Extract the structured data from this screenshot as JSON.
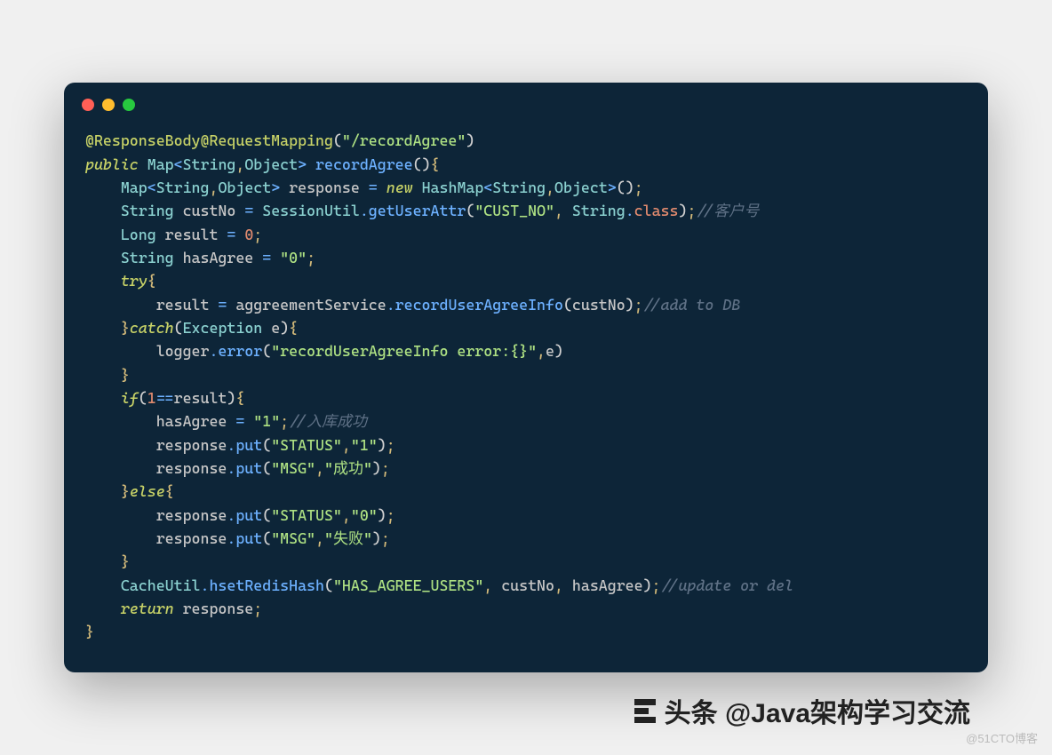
{
  "window": {
    "dots": [
      "red",
      "yellow",
      "green"
    ]
  },
  "code": {
    "lines": [
      [
        {
          "cls": "annotation",
          "t": "@ResponseBody@RequestMapping"
        },
        {
          "cls": "paren",
          "t": "("
        },
        {
          "cls": "string",
          "t": "\"/recordAgree\""
        },
        {
          "cls": "paren",
          "t": ")"
        }
      ],
      [
        {
          "cls": "keyword",
          "t": "public"
        },
        {
          "cls": "white",
          "t": " "
        },
        {
          "cls": "type",
          "t": "Map"
        },
        {
          "cls": "angle",
          "t": "<"
        },
        {
          "cls": "type",
          "t": "String"
        },
        {
          "cls": "punc",
          "t": ","
        },
        {
          "cls": "type",
          "t": "Object"
        },
        {
          "cls": "angle",
          "t": ">"
        },
        {
          "cls": "white",
          "t": " "
        },
        {
          "cls": "method",
          "t": "recordAgree"
        },
        {
          "cls": "paren",
          "t": "()"
        },
        {
          "cls": "punc",
          "t": "{"
        }
      ],
      [
        {
          "cls": "white",
          "t": "    "
        },
        {
          "cls": "type",
          "t": "Map"
        },
        {
          "cls": "angle",
          "t": "<"
        },
        {
          "cls": "type",
          "t": "String"
        },
        {
          "cls": "punc",
          "t": ","
        },
        {
          "cls": "type",
          "t": "Object"
        },
        {
          "cls": "angle",
          "t": ">"
        },
        {
          "cls": "white",
          "t": " "
        },
        {
          "cls": "identifier",
          "t": "response "
        },
        {
          "cls": "operator",
          "t": "="
        },
        {
          "cls": "white",
          "t": " "
        },
        {
          "cls": "keyword",
          "t": "new"
        },
        {
          "cls": "white",
          "t": " "
        },
        {
          "cls": "type",
          "t": "HashMap"
        },
        {
          "cls": "angle",
          "t": "<"
        },
        {
          "cls": "type",
          "t": "String"
        },
        {
          "cls": "punc",
          "t": ","
        },
        {
          "cls": "type",
          "t": "Object"
        },
        {
          "cls": "angle",
          "t": ">"
        },
        {
          "cls": "paren",
          "t": "()"
        },
        {
          "cls": "punc",
          "t": ";"
        }
      ],
      [
        {
          "cls": "white",
          "t": "    "
        },
        {
          "cls": "type",
          "t": "String"
        },
        {
          "cls": "white",
          "t": " "
        },
        {
          "cls": "identifier",
          "t": "custNo "
        },
        {
          "cls": "operator",
          "t": "="
        },
        {
          "cls": "white",
          "t": " "
        },
        {
          "cls": "type",
          "t": "SessionUtil"
        },
        {
          "cls": "dot-op",
          "t": "."
        },
        {
          "cls": "method",
          "t": "getUserAttr"
        },
        {
          "cls": "paren",
          "t": "("
        },
        {
          "cls": "string",
          "t": "\"CUST_NO\""
        },
        {
          "cls": "punc",
          "t": ", "
        },
        {
          "cls": "type",
          "t": "String"
        },
        {
          "cls": "dot-op",
          "t": "."
        },
        {
          "cls": "classlit",
          "t": "class"
        },
        {
          "cls": "paren",
          "t": ")"
        },
        {
          "cls": "punc",
          "t": ";"
        },
        {
          "cls": "comment",
          "t": "//客户号"
        }
      ],
      [
        {
          "cls": "white",
          "t": "    "
        },
        {
          "cls": "type",
          "t": "Long"
        },
        {
          "cls": "white",
          "t": " "
        },
        {
          "cls": "identifier",
          "t": "result "
        },
        {
          "cls": "operator",
          "t": "="
        },
        {
          "cls": "white",
          "t": " "
        },
        {
          "cls": "number",
          "t": "0"
        },
        {
          "cls": "punc",
          "t": ";"
        }
      ],
      [
        {
          "cls": "white",
          "t": "    "
        },
        {
          "cls": "type",
          "t": "String"
        },
        {
          "cls": "white",
          "t": " "
        },
        {
          "cls": "identifier",
          "t": "hasAgree "
        },
        {
          "cls": "operator",
          "t": "="
        },
        {
          "cls": "white",
          "t": " "
        },
        {
          "cls": "string",
          "t": "\"0\""
        },
        {
          "cls": "punc",
          "t": ";"
        }
      ],
      [
        {
          "cls": "white",
          "t": "    "
        },
        {
          "cls": "keyword",
          "t": "try"
        },
        {
          "cls": "punc",
          "t": "{"
        }
      ],
      [
        {
          "cls": "white",
          "t": "        "
        },
        {
          "cls": "identifier",
          "t": "result "
        },
        {
          "cls": "operator",
          "t": "="
        },
        {
          "cls": "white",
          "t": " "
        },
        {
          "cls": "identifier",
          "t": "aggreementService"
        },
        {
          "cls": "dot-op",
          "t": "."
        },
        {
          "cls": "method",
          "t": "recordUserAgreeInfo"
        },
        {
          "cls": "paren",
          "t": "("
        },
        {
          "cls": "identifier",
          "t": "custNo"
        },
        {
          "cls": "paren",
          "t": ")"
        },
        {
          "cls": "punc",
          "t": ";"
        },
        {
          "cls": "comment",
          "t": "//add to DB"
        }
      ],
      [
        {
          "cls": "white",
          "t": "    "
        },
        {
          "cls": "punc",
          "t": "}"
        },
        {
          "cls": "keyword",
          "t": "catch"
        },
        {
          "cls": "paren",
          "t": "("
        },
        {
          "cls": "type",
          "t": "Exception"
        },
        {
          "cls": "white",
          "t": " "
        },
        {
          "cls": "identifier",
          "t": "e"
        },
        {
          "cls": "paren",
          "t": ")"
        },
        {
          "cls": "punc",
          "t": "{"
        }
      ],
      [
        {
          "cls": "white",
          "t": "        "
        },
        {
          "cls": "identifier",
          "t": "logger"
        },
        {
          "cls": "dot-op",
          "t": "."
        },
        {
          "cls": "method",
          "t": "error"
        },
        {
          "cls": "paren",
          "t": "("
        },
        {
          "cls": "string",
          "t": "\"recordUserAgreeInfo error:{}\""
        },
        {
          "cls": "punc",
          "t": ","
        },
        {
          "cls": "identifier",
          "t": "e"
        },
        {
          "cls": "paren",
          "t": ")"
        }
      ],
      [
        {
          "cls": "white",
          "t": "    "
        },
        {
          "cls": "punc",
          "t": "}"
        }
      ],
      [
        {
          "cls": "white",
          "t": "    "
        },
        {
          "cls": "keyword",
          "t": "if"
        },
        {
          "cls": "paren",
          "t": "("
        },
        {
          "cls": "number",
          "t": "1"
        },
        {
          "cls": "operator",
          "t": "=="
        },
        {
          "cls": "identifier",
          "t": "result"
        },
        {
          "cls": "paren",
          "t": ")"
        },
        {
          "cls": "punc",
          "t": "{"
        }
      ],
      [
        {
          "cls": "white",
          "t": "        "
        },
        {
          "cls": "identifier",
          "t": "hasAgree "
        },
        {
          "cls": "operator",
          "t": "="
        },
        {
          "cls": "white",
          "t": " "
        },
        {
          "cls": "string",
          "t": "\"1\""
        },
        {
          "cls": "punc",
          "t": ";"
        },
        {
          "cls": "comment",
          "t": "//入库成功"
        }
      ],
      [
        {
          "cls": "white",
          "t": "        "
        },
        {
          "cls": "identifier",
          "t": "response"
        },
        {
          "cls": "dot-op",
          "t": "."
        },
        {
          "cls": "method",
          "t": "put"
        },
        {
          "cls": "paren",
          "t": "("
        },
        {
          "cls": "string",
          "t": "\"STATUS\""
        },
        {
          "cls": "punc",
          "t": ","
        },
        {
          "cls": "string",
          "t": "\"1\""
        },
        {
          "cls": "paren",
          "t": ")"
        },
        {
          "cls": "punc",
          "t": ";"
        }
      ],
      [
        {
          "cls": "white",
          "t": "        "
        },
        {
          "cls": "identifier",
          "t": "response"
        },
        {
          "cls": "dot-op",
          "t": "."
        },
        {
          "cls": "method",
          "t": "put"
        },
        {
          "cls": "paren",
          "t": "("
        },
        {
          "cls": "string",
          "t": "\"MSG\""
        },
        {
          "cls": "punc",
          "t": ","
        },
        {
          "cls": "string",
          "t": "\"成功\""
        },
        {
          "cls": "paren",
          "t": ")"
        },
        {
          "cls": "punc",
          "t": ";"
        }
      ],
      [
        {
          "cls": "white",
          "t": "    "
        },
        {
          "cls": "punc",
          "t": "}"
        },
        {
          "cls": "keyword",
          "t": "else"
        },
        {
          "cls": "punc",
          "t": "{"
        }
      ],
      [
        {
          "cls": "white",
          "t": "        "
        },
        {
          "cls": "identifier",
          "t": "response"
        },
        {
          "cls": "dot-op",
          "t": "."
        },
        {
          "cls": "method",
          "t": "put"
        },
        {
          "cls": "paren",
          "t": "("
        },
        {
          "cls": "string",
          "t": "\"STATUS\""
        },
        {
          "cls": "punc",
          "t": ","
        },
        {
          "cls": "string",
          "t": "\"0\""
        },
        {
          "cls": "paren",
          "t": ")"
        },
        {
          "cls": "punc",
          "t": ";"
        }
      ],
      [
        {
          "cls": "white",
          "t": "        "
        },
        {
          "cls": "identifier",
          "t": "response"
        },
        {
          "cls": "dot-op",
          "t": "."
        },
        {
          "cls": "method",
          "t": "put"
        },
        {
          "cls": "paren",
          "t": "("
        },
        {
          "cls": "string",
          "t": "\"MSG\""
        },
        {
          "cls": "punc",
          "t": ","
        },
        {
          "cls": "string",
          "t": "\"失败\""
        },
        {
          "cls": "paren",
          "t": ")"
        },
        {
          "cls": "punc",
          "t": ";"
        }
      ],
      [
        {
          "cls": "white",
          "t": "    "
        },
        {
          "cls": "punc",
          "t": "}"
        }
      ],
      [
        {
          "cls": "white",
          "t": "    "
        },
        {
          "cls": "type",
          "t": "CacheUtil"
        },
        {
          "cls": "dot-op",
          "t": "."
        },
        {
          "cls": "method",
          "t": "hsetRedisHash"
        },
        {
          "cls": "paren",
          "t": "("
        },
        {
          "cls": "string",
          "t": "\"HAS_AGREE_USERS\""
        },
        {
          "cls": "punc",
          "t": ", "
        },
        {
          "cls": "identifier",
          "t": "custNo"
        },
        {
          "cls": "punc",
          "t": ", "
        },
        {
          "cls": "identifier",
          "t": "hasAgree"
        },
        {
          "cls": "paren",
          "t": ")"
        },
        {
          "cls": "punc",
          "t": ";"
        },
        {
          "cls": "comment",
          "t": "//update or del"
        }
      ],
      [
        {
          "cls": "white",
          "t": "    "
        },
        {
          "cls": "keyword",
          "t": "return"
        },
        {
          "cls": "white",
          "t": " "
        },
        {
          "cls": "identifier",
          "t": "response"
        },
        {
          "cls": "punc",
          "t": ";"
        }
      ],
      [
        {
          "cls": "punc",
          "t": "}"
        }
      ]
    ]
  },
  "footer": {
    "label": "头条 @Java架构学习交流"
  },
  "watermark": {
    "text": "@51CTO博客"
  }
}
